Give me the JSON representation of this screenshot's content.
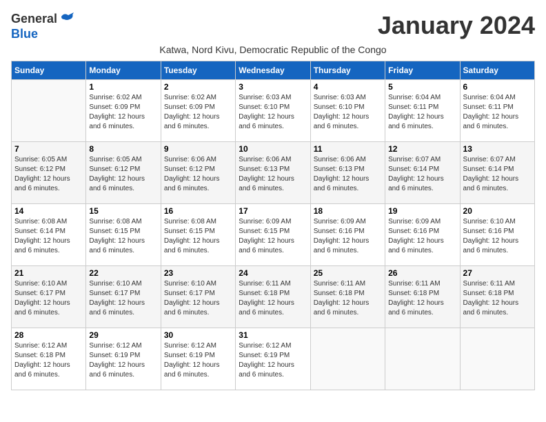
{
  "header": {
    "logo_general": "General",
    "logo_blue": "Blue",
    "month_title": "January 2024",
    "subtitle": "Katwa, Nord Kivu, Democratic Republic of the Congo"
  },
  "days_of_week": [
    "Sunday",
    "Monday",
    "Tuesday",
    "Wednesday",
    "Thursday",
    "Friday",
    "Saturday"
  ],
  "weeks": [
    [
      {
        "day": "",
        "sunrise": "",
        "sunset": "",
        "daylight": ""
      },
      {
        "day": "1",
        "sunrise": "Sunrise: 6:02 AM",
        "sunset": "Sunset: 6:09 PM",
        "daylight": "Daylight: 12 hours and 6 minutes."
      },
      {
        "day": "2",
        "sunrise": "Sunrise: 6:02 AM",
        "sunset": "Sunset: 6:09 PM",
        "daylight": "Daylight: 12 hours and 6 minutes."
      },
      {
        "day": "3",
        "sunrise": "Sunrise: 6:03 AM",
        "sunset": "Sunset: 6:10 PM",
        "daylight": "Daylight: 12 hours and 6 minutes."
      },
      {
        "day": "4",
        "sunrise": "Sunrise: 6:03 AM",
        "sunset": "Sunset: 6:10 PM",
        "daylight": "Daylight: 12 hours and 6 minutes."
      },
      {
        "day": "5",
        "sunrise": "Sunrise: 6:04 AM",
        "sunset": "Sunset: 6:11 PM",
        "daylight": "Daylight: 12 hours and 6 minutes."
      },
      {
        "day": "6",
        "sunrise": "Sunrise: 6:04 AM",
        "sunset": "Sunset: 6:11 PM",
        "daylight": "Daylight: 12 hours and 6 minutes."
      }
    ],
    [
      {
        "day": "7",
        "sunrise": "Sunrise: 6:05 AM",
        "sunset": "Sunset: 6:12 PM",
        "daylight": "Daylight: 12 hours and 6 minutes."
      },
      {
        "day": "8",
        "sunrise": "Sunrise: 6:05 AM",
        "sunset": "Sunset: 6:12 PM",
        "daylight": "Daylight: 12 hours and 6 minutes."
      },
      {
        "day": "9",
        "sunrise": "Sunrise: 6:06 AM",
        "sunset": "Sunset: 6:12 PM",
        "daylight": "Daylight: 12 hours and 6 minutes."
      },
      {
        "day": "10",
        "sunrise": "Sunrise: 6:06 AM",
        "sunset": "Sunset: 6:13 PM",
        "daylight": "Daylight: 12 hours and 6 minutes."
      },
      {
        "day": "11",
        "sunrise": "Sunrise: 6:06 AM",
        "sunset": "Sunset: 6:13 PM",
        "daylight": "Daylight: 12 hours and 6 minutes."
      },
      {
        "day": "12",
        "sunrise": "Sunrise: 6:07 AM",
        "sunset": "Sunset: 6:14 PM",
        "daylight": "Daylight: 12 hours and 6 minutes."
      },
      {
        "day": "13",
        "sunrise": "Sunrise: 6:07 AM",
        "sunset": "Sunset: 6:14 PM",
        "daylight": "Daylight: 12 hours and 6 minutes."
      }
    ],
    [
      {
        "day": "14",
        "sunrise": "Sunrise: 6:08 AM",
        "sunset": "Sunset: 6:14 PM",
        "daylight": "Daylight: 12 hours and 6 minutes."
      },
      {
        "day": "15",
        "sunrise": "Sunrise: 6:08 AM",
        "sunset": "Sunset: 6:15 PM",
        "daylight": "Daylight: 12 hours and 6 minutes."
      },
      {
        "day": "16",
        "sunrise": "Sunrise: 6:08 AM",
        "sunset": "Sunset: 6:15 PM",
        "daylight": "Daylight: 12 hours and 6 minutes."
      },
      {
        "day": "17",
        "sunrise": "Sunrise: 6:09 AM",
        "sunset": "Sunset: 6:15 PM",
        "daylight": "Daylight: 12 hours and 6 minutes."
      },
      {
        "day": "18",
        "sunrise": "Sunrise: 6:09 AM",
        "sunset": "Sunset: 6:16 PM",
        "daylight": "Daylight: 12 hours and 6 minutes."
      },
      {
        "day": "19",
        "sunrise": "Sunrise: 6:09 AM",
        "sunset": "Sunset: 6:16 PM",
        "daylight": "Daylight: 12 hours and 6 minutes."
      },
      {
        "day": "20",
        "sunrise": "Sunrise: 6:10 AM",
        "sunset": "Sunset: 6:16 PM",
        "daylight": "Daylight: 12 hours and 6 minutes."
      }
    ],
    [
      {
        "day": "21",
        "sunrise": "Sunrise: 6:10 AM",
        "sunset": "Sunset: 6:17 PM",
        "daylight": "Daylight: 12 hours and 6 minutes."
      },
      {
        "day": "22",
        "sunrise": "Sunrise: 6:10 AM",
        "sunset": "Sunset: 6:17 PM",
        "daylight": "Daylight: 12 hours and 6 minutes."
      },
      {
        "day": "23",
        "sunrise": "Sunrise: 6:10 AM",
        "sunset": "Sunset: 6:17 PM",
        "daylight": "Daylight: 12 hours and 6 minutes."
      },
      {
        "day": "24",
        "sunrise": "Sunrise: 6:11 AM",
        "sunset": "Sunset: 6:18 PM",
        "daylight": "Daylight: 12 hours and 6 minutes."
      },
      {
        "day": "25",
        "sunrise": "Sunrise: 6:11 AM",
        "sunset": "Sunset: 6:18 PM",
        "daylight": "Daylight: 12 hours and 6 minutes."
      },
      {
        "day": "26",
        "sunrise": "Sunrise: 6:11 AM",
        "sunset": "Sunset: 6:18 PM",
        "daylight": "Daylight: 12 hours and 6 minutes."
      },
      {
        "day": "27",
        "sunrise": "Sunrise: 6:11 AM",
        "sunset": "Sunset: 6:18 PM",
        "daylight": "Daylight: 12 hours and 6 minutes."
      }
    ],
    [
      {
        "day": "28",
        "sunrise": "Sunrise: 6:12 AM",
        "sunset": "Sunset: 6:18 PM",
        "daylight": "Daylight: 12 hours and 6 minutes."
      },
      {
        "day": "29",
        "sunrise": "Sunrise: 6:12 AM",
        "sunset": "Sunset: 6:19 PM",
        "daylight": "Daylight: 12 hours and 6 minutes."
      },
      {
        "day": "30",
        "sunrise": "Sunrise: 6:12 AM",
        "sunset": "Sunset: 6:19 PM",
        "daylight": "Daylight: 12 hours and 6 minutes."
      },
      {
        "day": "31",
        "sunrise": "Sunrise: 6:12 AM",
        "sunset": "Sunset: 6:19 PM",
        "daylight": "Daylight: 12 hours and 6 minutes."
      },
      {
        "day": "",
        "sunrise": "",
        "sunset": "",
        "daylight": ""
      },
      {
        "day": "",
        "sunrise": "",
        "sunset": "",
        "daylight": ""
      },
      {
        "day": "",
        "sunrise": "",
        "sunset": "",
        "daylight": ""
      }
    ]
  ]
}
